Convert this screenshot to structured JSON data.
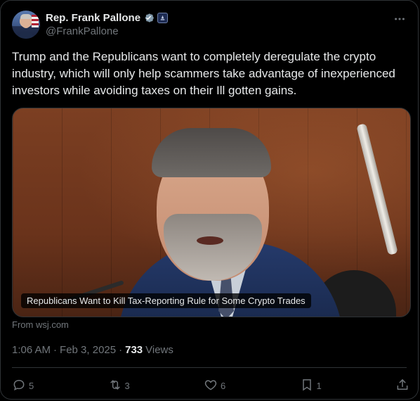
{
  "author": {
    "display_name": "Rep. Frank Pallone",
    "handle": "@FrankPallone"
  },
  "tweet": {
    "text": "Trump and the Republicans want to completely deregulate the crypto industry, which will only help scammers take advantage of inexperienced investors while avoiding taxes on their Ill gotten gains."
  },
  "media": {
    "caption": "Republicans Want to Kill Tax-Reporting Rule for Some Crypto Trades",
    "source": "From wsj.com"
  },
  "meta": {
    "time": "1:06 AM",
    "separator": "·",
    "date": "Feb 3, 2025",
    "views_count": "733",
    "views_label": "Views"
  },
  "actions": {
    "replies": "5",
    "reposts": "3",
    "likes": "6",
    "bookmarks": "1"
  },
  "icons": {
    "verified": "verified-badge-icon",
    "gov": "government-badge-icon",
    "more": "more-icon",
    "reply": "reply-icon",
    "repost": "repost-icon",
    "like": "heart-icon",
    "bookmark": "bookmark-icon",
    "share": "share-icon"
  },
  "colors": {
    "background": "#000000",
    "text": "#e7e9ea",
    "secondary": "#71767b",
    "border": "#2f3336",
    "verified": "#829aab"
  }
}
